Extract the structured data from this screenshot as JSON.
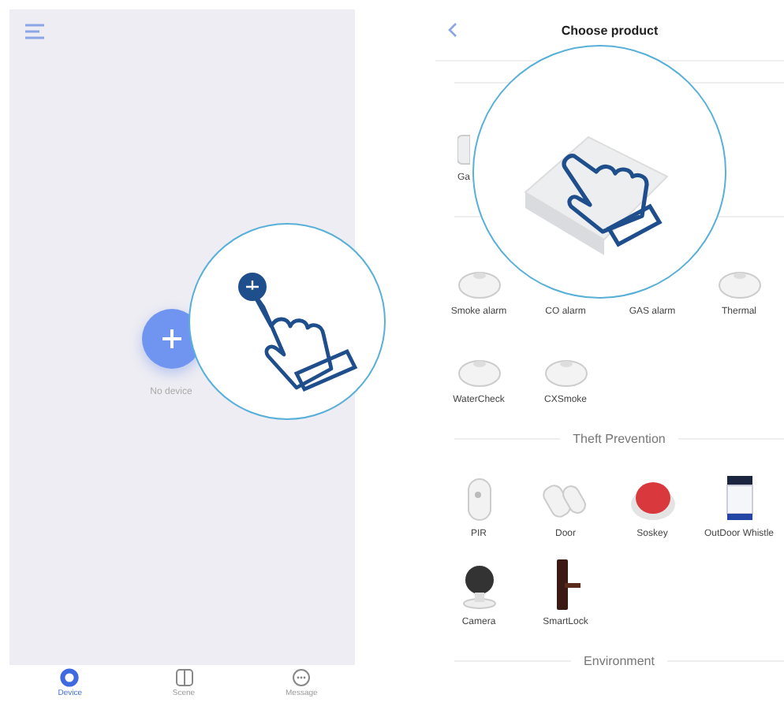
{
  "left_screen": {
    "empty_text": "No device",
    "tabs": [
      {
        "label": "Device",
        "kind": "device",
        "selected": true
      },
      {
        "label": "Scene",
        "kind": "scene",
        "selected": false
      },
      {
        "label": "Message",
        "kind": "message",
        "selected": false
      }
    ]
  },
  "right_screen": {
    "title": "Choose product",
    "sections": [
      {
        "products": [
          {
            "label": "Ga",
            "kind": "gateway"
          }
        ]
      },
      {
        "products": [
          {
            "label": "Smoke alarm",
            "kind": "detector"
          },
          {
            "label": "CO alarm",
            "kind": "covered"
          },
          {
            "label": "GAS alarm",
            "kind": "covered"
          },
          {
            "label": "Thermal",
            "kind": "detector"
          },
          {
            "label": "WaterCheck",
            "kind": "detector"
          },
          {
            "label": "CXSmoke",
            "kind": "detector"
          }
        ]
      },
      {
        "heading": "Theft Prevention",
        "products": [
          {
            "label": "PIR",
            "kind": "pir"
          },
          {
            "label": "Door",
            "kind": "door"
          },
          {
            "label": "Soskey",
            "kind": "button"
          },
          {
            "label": "OutDoor Whistle",
            "kind": "siren"
          },
          {
            "label": "Camera",
            "kind": "camera"
          },
          {
            "label": "SmartLock",
            "kind": "lock"
          }
        ]
      },
      {
        "heading": "Environment"
      }
    ]
  }
}
